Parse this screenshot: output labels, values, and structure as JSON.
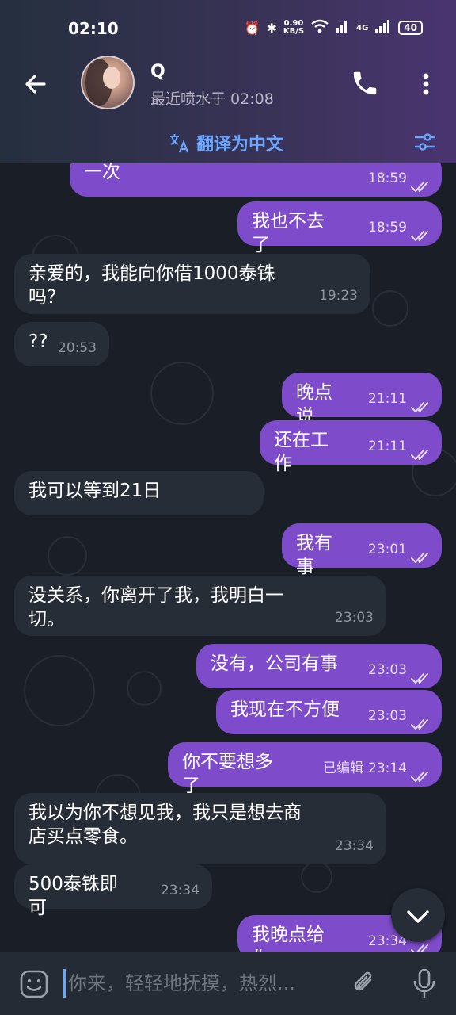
{
  "status_bar": {
    "time": "02:10",
    "net_speed_value": "0.90",
    "net_speed_unit": "KB/S",
    "signal_type": "4G",
    "battery": "40"
  },
  "header": {
    "contact_name": "Q",
    "contact_status": "最近喷水于 02:08",
    "translate_label": "翻译为中文"
  },
  "messages": [
    {
      "dir": "out",
      "text": "一次",
      "time": "18:59",
      "read": true
    },
    {
      "dir": "out",
      "text": "我也不去了",
      "time": "18:59",
      "read": true
    },
    {
      "dir": "in",
      "text": "亲爱的，我能向你借1000泰铢吗？",
      "time": "19:23"
    },
    {
      "dir": "in",
      "text": "??",
      "time": "20:53"
    },
    {
      "dir": "out",
      "text": "晚点说",
      "time": "21:11",
      "read": true
    },
    {
      "dir": "out",
      "text": "还在工作",
      "time": "21:11",
      "read": true
    },
    {
      "dir": "in",
      "text": "我可以等到21日",
      "time": ""
    },
    {
      "dir": "out",
      "text": "我有事",
      "time": "23:01",
      "read": true
    },
    {
      "dir": "in",
      "text": "没关系，你离开了我，我明白一切。",
      "time": "23:03"
    },
    {
      "dir": "out",
      "text": "没有，公司有事",
      "time": "23:03",
      "read": true
    },
    {
      "dir": "out",
      "text": "我现在不方便",
      "time": "23:03",
      "read": true
    },
    {
      "dir": "out",
      "text": "你不要想多了",
      "edited": "已编辑",
      "time": "23:14",
      "read": true
    },
    {
      "dir": "in",
      "text": "我以为你不想见我，我只是想去商店买点零食。",
      "time": "23:34"
    },
    {
      "dir": "in",
      "text": "500泰铢即可",
      "time": "23:34"
    },
    {
      "dir": "out",
      "text": "我晚点给你",
      "time": "23:34",
      "read": true
    }
  ],
  "composer": {
    "placeholder": "你来，轻轻地抚摸，热烈..."
  },
  "colors": {
    "outgoing_bubble": "#7e4ccb",
    "incoming_bubble": "#262d36",
    "accent": "#6aa6ff",
    "background": "#1a1f27"
  },
  "icons": [
    "back-arrow-icon",
    "phone-icon",
    "more-vert-icon",
    "translate-icon",
    "filter-icon",
    "double-check-icon",
    "chevron-down-icon",
    "emoji-icon",
    "paperclip-icon",
    "microphone-icon"
  ]
}
